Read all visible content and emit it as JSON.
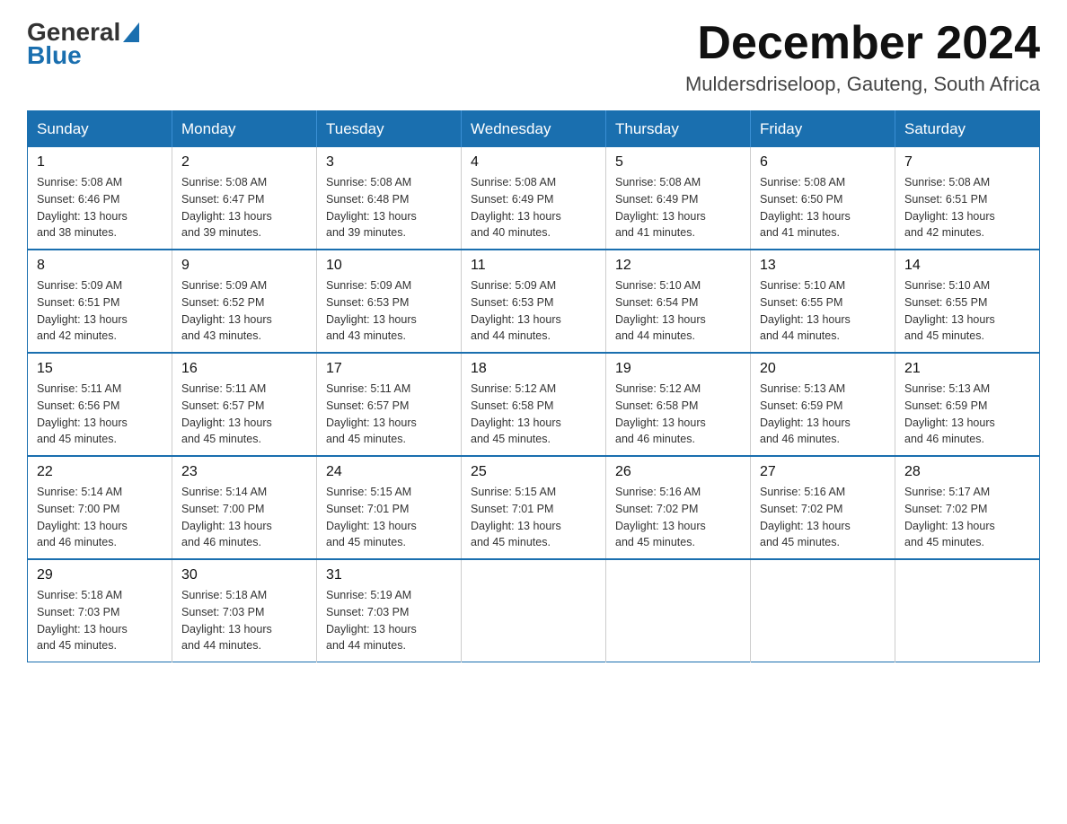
{
  "header": {
    "logo_general": "General",
    "logo_blue": "Blue",
    "month_title": "December 2024",
    "subtitle": "Muldersdriseloop, Gauteng, South Africa"
  },
  "weekdays": [
    "Sunday",
    "Monday",
    "Tuesday",
    "Wednesday",
    "Thursday",
    "Friday",
    "Saturday"
  ],
  "weeks": [
    [
      {
        "day": "1",
        "info": "Sunrise: 5:08 AM\nSunset: 6:46 PM\nDaylight: 13 hours\nand 38 minutes."
      },
      {
        "day": "2",
        "info": "Sunrise: 5:08 AM\nSunset: 6:47 PM\nDaylight: 13 hours\nand 39 minutes."
      },
      {
        "day": "3",
        "info": "Sunrise: 5:08 AM\nSunset: 6:48 PM\nDaylight: 13 hours\nand 39 minutes."
      },
      {
        "day": "4",
        "info": "Sunrise: 5:08 AM\nSunset: 6:49 PM\nDaylight: 13 hours\nand 40 minutes."
      },
      {
        "day": "5",
        "info": "Sunrise: 5:08 AM\nSunset: 6:49 PM\nDaylight: 13 hours\nand 41 minutes."
      },
      {
        "day": "6",
        "info": "Sunrise: 5:08 AM\nSunset: 6:50 PM\nDaylight: 13 hours\nand 41 minutes."
      },
      {
        "day": "7",
        "info": "Sunrise: 5:08 AM\nSunset: 6:51 PM\nDaylight: 13 hours\nand 42 minutes."
      }
    ],
    [
      {
        "day": "8",
        "info": "Sunrise: 5:09 AM\nSunset: 6:51 PM\nDaylight: 13 hours\nand 42 minutes."
      },
      {
        "day": "9",
        "info": "Sunrise: 5:09 AM\nSunset: 6:52 PM\nDaylight: 13 hours\nand 43 minutes."
      },
      {
        "day": "10",
        "info": "Sunrise: 5:09 AM\nSunset: 6:53 PM\nDaylight: 13 hours\nand 43 minutes."
      },
      {
        "day": "11",
        "info": "Sunrise: 5:09 AM\nSunset: 6:53 PM\nDaylight: 13 hours\nand 44 minutes."
      },
      {
        "day": "12",
        "info": "Sunrise: 5:10 AM\nSunset: 6:54 PM\nDaylight: 13 hours\nand 44 minutes."
      },
      {
        "day": "13",
        "info": "Sunrise: 5:10 AM\nSunset: 6:55 PM\nDaylight: 13 hours\nand 44 minutes."
      },
      {
        "day": "14",
        "info": "Sunrise: 5:10 AM\nSunset: 6:55 PM\nDaylight: 13 hours\nand 45 minutes."
      }
    ],
    [
      {
        "day": "15",
        "info": "Sunrise: 5:11 AM\nSunset: 6:56 PM\nDaylight: 13 hours\nand 45 minutes."
      },
      {
        "day": "16",
        "info": "Sunrise: 5:11 AM\nSunset: 6:57 PM\nDaylight: 13 hours\nand 45 minutes."
      },
      {
        "day": "17",
        "info": "Sunrise: 5:11 AM\nSunset: 6:57 PM\nDaylight: 13 hours\nand 45 minutes."
      },
      {
        "day": "18",
        "info": "Sunrise: 5:12 AM\nSunset: 6:58 PM\nDaylight: 13 hours\nand 45 minutes."
      },
      {
        "day": "19",
        "info": "Sunrise: 5:12 AM\nSunset: 6:58 PM\nDaylight: 13 hours\nand 46 minutes."
      },
      {
        "day": "20",
        "info": "Sunrise: 5:13 AM\nSunset: 6:59 PM\nDaylight: 13 hours\nand 46 minutes."
      },
      {
        "day": "21",
        "info": "Sunrise: 5:13 AM\nSunset: 6:59 PM\nDaylight: 13 hours\nand 46 minutes."
      }
    ],
    [
      {
        "day": "22",
        "info": "Sunrise: 5:14 AM\nSunset: 7:00 PM\nDaylight: 13 hours\nand 46 minutes."
      },
      {
        "day": "23",
        "info": "Sunrise: 5:14 AM\nSunset: 7:00 PM\nDaylight: 13 hours\nand 46 minutes."
      },
      {
        "day": "24",
        "info": "Sunrise: 5:15 AM\nSunset: 7:01 PM\nDaylight: 13 hours\nand 45 minutes."
      },
      {
        "day": "25",
        "info": "Sunrise: 5:15 AM\nSunset: 7:01 PM\nDaylight: 13 hours\nand 45 minutes."
      },
      {
        "day": "26",
        "info": "Sunrise: 5:16 AM\nSunset: 7:02 PM\nDaylight: 13 hours\nand 45 minutes."
      },
      {
        "day": "27",
        "info": "Sunrise: 5:16 AM\nSunset: 7:02 PM\nDaylight: 13 hours\nand 45 minutes."
      },
      {
        "day": "28",
        "info": "Sunrise: 5:17 AM\nSunset: 7:02 PM\nDaylight: 13 hours\nand 45 minutes."
      }
    ],
    [
      {
        "day": "29",
        "info": "Sunrise: 5:18 AM\nSunset: 7:03 PM\nDaylight: 13 hours\nand 45 minutes."
      },
      {
        "day": "30",
        "info": "Sunrise: 5:18 AM\nSunset: 7:03 PM\nDaylight: 13 hours\nand 44 minutes."
      },
      {
        "day": "31",
        "info": "Sunrise: 5:19 AM\nSunset: 7:03 PM\nDaylight: 13 hours\nand 44 minutes."
      },
      null,
      null,
      null,
      null
    ]
  ]
}
